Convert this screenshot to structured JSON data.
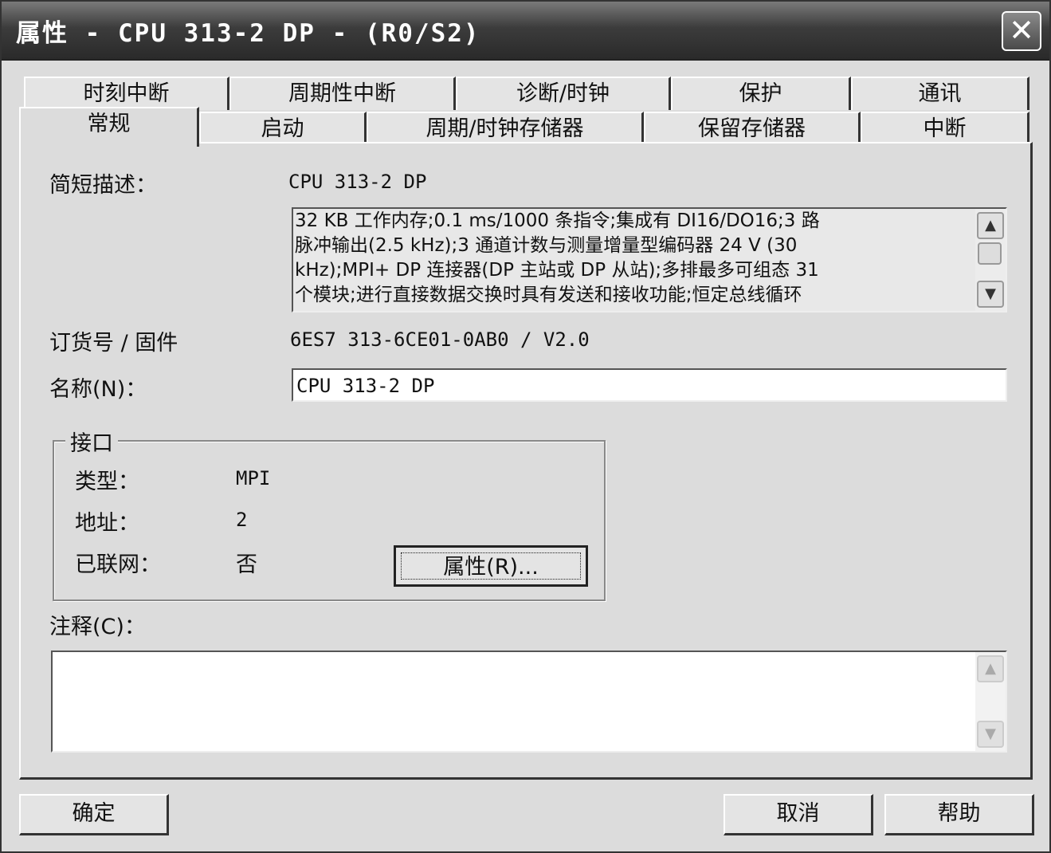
{
  "window": {
    "title": "属性 - CPU 313-2 DP - (R0/S2)",
    "close_glyph": "✕"
  },
  "tabs": {
    "row_back": [
      "时刻中断",
      "周期性中断",
      "诊断/时钟",
      "保护",
      "通讯"
    ],
    "row_front": [
      "常规",
      "启动",
      "周期/时钟存储器",
      "保留存储器",
      "中断"
    ],
    "active": "常规"
  },
  "general": {
    "short_desc_label": "简短描述：",
    "short_desc_value": "CPU 313-2 DP",
    "description_lines": [
      "32 KB 工作内存;0.1 ms/1000 条指令;集成有 DI16/DO16;3 路",
      "脉冲输出(2.5 kHz);3 通道计数与测量增量型编码器 24 V (30",
      "kHz);MPI+ DP 连接器(DP 主站或 DP 从站);多排最多可组态 31",
      "个模块;进行直接数据交换时具有发送和接收功能;恒定总线循环"
    ],
    "order_label": "订货号 / 固件",
    "order_value": "6ES7 313-6CE01-0AB0 / V2.0",
    "name_label": "名称(N)：",
    "name_value": "CPU 313-2 DP",
    "interface": {
      "group_title": "接口",
      "type_label": "类型：",
      "type_value": "MPI",
      "address_label": "地址：",
      "address_value": "2",
      "networked_label": "已联网：",
      "networked_value": "否",
      "properties_button": "属性(R)..."
    },
    "comment_label": "注释(C)：",
    "comment_value": ""
  },
  "footer": {
    "ok": "确定",
    "cancel": "取消",
    "help": "帮助"
  }
}
